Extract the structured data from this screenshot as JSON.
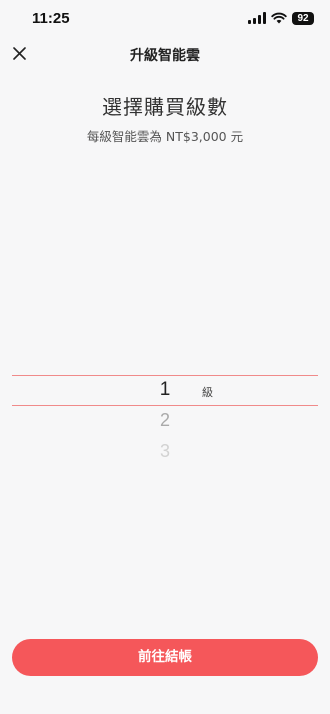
{
  "status_bar": {
    "time": "11:25",
    "battery_level": "92",
    "icons": [
      "signal-icon",
      "wifi-icon",
      "battery-icon"
    ]
  },
  "header": {
    "title": "升級智能雲",
    "close_icon": "close-icon"
  },
  "content": {
    "headline": "選擇購買級數",
    "subline": "每級智能雲為 NT$3,000 元"
  },
  "picker": {
    "selected_value": "1",
    "unit_label": "級",
    "visible_options": [
      "2",
      "3"
    ]
  },
  "footer": {
    "checkout_label": "前往結帳"
  },
  "colors": {
    "accent": "#f5575a",
    "picker_line": "#f08a8a",
    "background": "#f7f7f8"
  }
}
